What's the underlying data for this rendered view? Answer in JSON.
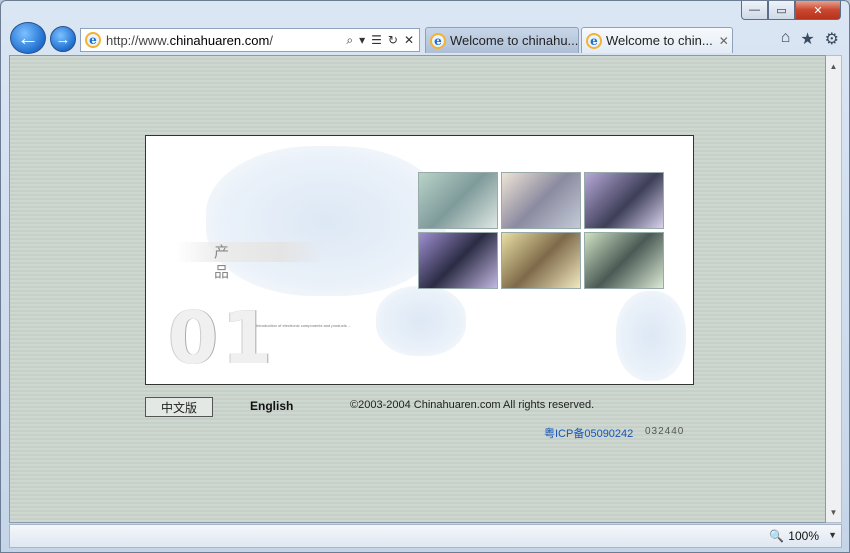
{
  "window": {
    "controls": {
      "minimize": "—",
      "maximize": "▭",
      "close": "✕"
    }
  },
  "toolbar": {
    "back_icon": "←",
    "forward_icon": "→",
    "address_prefix": "http://www.",
    "address_host": "chinahuaren.com",
    "address_suffix": "/",
    "search_icon": "⌕",
    "dropdown_icon": "▾",
    "compat_icon": "☰",
    "refresh_icon": "↻",
    "stop_icon": "✕",
    "home_icon": "⌂",
    "favorites_icon": "★",
    "tools_icon": "⚙"
  },
  "tabs": [
    {
      "title": "Welcome to chinahu...",
      "active": false
    },
    {
      "title": "Welcome to chin...",
      "active": true,
      "close_icon": "✕"
    }
  ],
  "page": {
    "banner": {
      "label": "产 品",
      "number": "01",
      "caption": "Introduction of electronic components and products ..."
    },
    "lang_chinese": "中文版",
    "lang_english": "English",
    "copyright": "©2003-2004 Chinahuaren.com  All rights reserved.",
    "icp": "粤ICP备05090242",
    "counter": "032440"
  },
  "statusbar": {
    "zoom_icon": "🔍",
    "zoom": "100%",
    "zoom_dropdown": "▼"
  },
  "scrollbar": {
    "up": "▲",
    "down": "▼"
  }
}
